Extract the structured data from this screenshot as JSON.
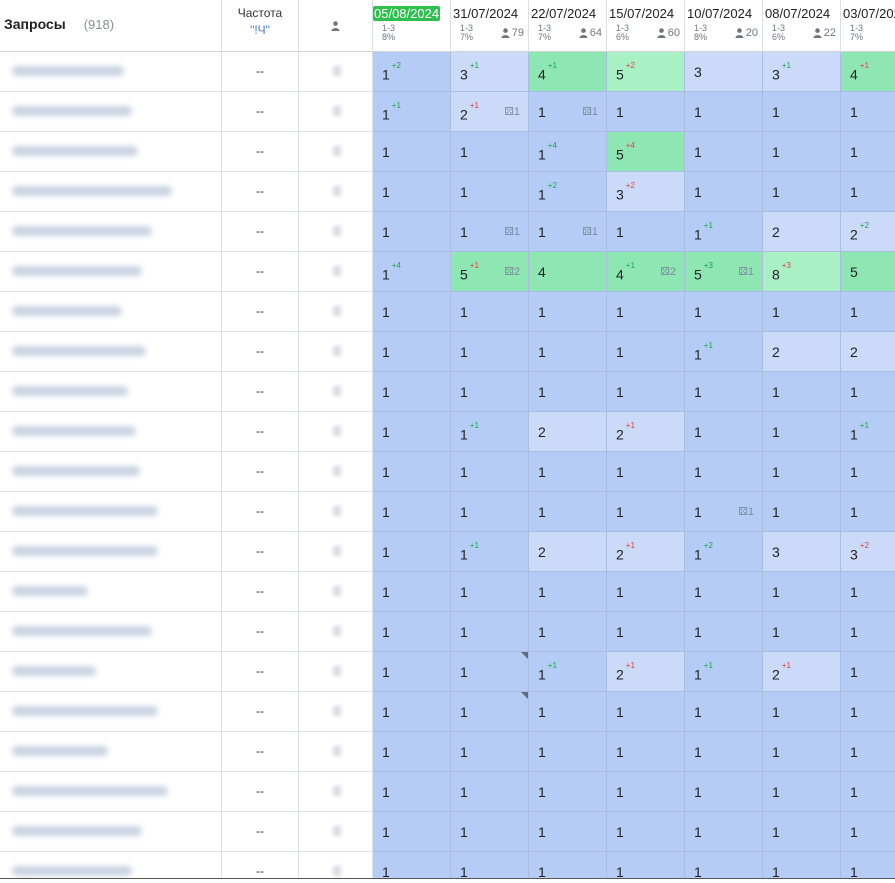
{
  "header": {
    "queries_label": "Запросы",
    "queries_count": "(918)",
    "frequency_label": "Частота",
    "frequency_sub": "\"!Ч\""
  },
  "columns": [
    {
      "date": "05/08/2024",
      "range": "1-3",
      "pct": "8%",
      "users": "",
      "highlight": true
    },
    {
      "date": "31/07/2024",
      "range": "1-3",
      "pct": "7%",
      "users": "79",
      "highlight": false
    },
    {
      "date": "22/07/2024",
      "range": "1-3",
      "pct": "7%",
      "users": "64",
      "highlight": false
    },
    {
      "date": "15/07/2024",
      "range": "1-3",
      "pct": "6%",
      "users": "60",
      "highlight": false
    },
    {
      "date": "10/07/2024",
      "range": "1-3",
      "pct": "8%",
      "users": "20",
      "highlight": false
    },
    {
      "date": "08/07/2024",
      "range": "1-3",
      "pct": "6%",
      "users": "22",
      "highlight": false
    },
    {
      "date": "03/07/2024",
      "range": "1-3",
      "pct": "7%",
      "users": "",
      "highlight": false
    }
  ],
  "rows": [
    {
      "freq": "--",
      "cells": [
        {
          "v": "1",
          "d": "+2",
          "t": "up",
          "c": 1
        },
        {
          "v": "3",
          "d": "+1",
          "t": "up",
          "c": 2
        },
        {
          "v": "4",
          "d": "+1",
          "t": "up",
          "c": 3
        },
        {
          "v": "5",
          "d": "+2",
          "t": "dn",
          "c": 4
        },
        {
          "v": "3",
          "c": 2
        },
        {
          "v": "3",
          "d": "+1",
          "t": "up",
          "c": 2
        },
        {
          "v": "4",
          "d": "+1",
          "t": "dn",
          "c": 3
        }
      ]
    },
    {
      "freq": "--",
      "cells": [
        {
          "v": "1",
          "d": "+1",
          "t": "up",
          "c": 1
        },
        {
          "v": "2",
          "d": "+1",
          "t": "dn",
          "s": "1",
          "c": 2
        },
        {
          "v": "1",
          "s": "1",
          "c": 1
        },
        {
          "v": "1",
          "c": 1
        },
        {
          "v": "1",
          "c": 1
        },
        {
          "v": "1",
          "c": 1
        },
        {
          "v": "1",
          "s": "",
          "c": 1
        }
      ]
    },
    {
      "freq": "--",
      "cells": [
        {
          "v": "1",
          "c": 1
        },
        {
          "v": "1",
          "c": 1
        },
        {
          "v": "1",
          "d": "+4",
          "t": "up",
          "c": 1
        },
        {
          "v": "5",
          "d": "+4",
          "t": "dn",
          "c": 3
        },
        {
          "v": "1",
          "c": 1
        },
        {
          "v": "1",
          "c": 1
        },
        {
          "v": "1",
          "c": 1
        }
      ]
    },
    {
      "freq": "--",
      "cells": [
        {
          "v": "1",
          "c": 1
        },
        {
          "v": "1",
          "c": 1
        },
        {
          "v": "1",
          "d": "+2",
          "t": "up",
          "c": 1
        },
        {
          "v": "3",
          "d": "+2",
          "t": "dn",
          "c": 2
        },
        {
          "v": "1",
          "c": 1
        },
        {
          "v": "1",
          "c": 1
        },
        {
          "v": "1",
          "c": 1
        }
      ]
    },
    {
      "freq": "--",
      "cells": [
        {
          "v": "1",
          "c": 1
        },
        {
          "v": "1",
          "s": "1",
          "c": 1
        },
        {
          "v": "1",
          "s": "1",
          "c": 1
        },
        {
          "v": "1",
          "c": 1
        },
        {
          "v": "1",
          "d": "+1",
          "t": "up",
          "c": 1
        },
        {
          "v": "2",
          "c": 2
        },
        {
          "v": "2",
          "d": "+2",
          "t": "up",
          "c": 2
        }
      ]
    },
    {
      "freq": "--",
      "cells": [
        {
          "v": "1",
          "d": "+4",
          "t": "up",
          "c": 1
        },
        {
          "v": "5",
          "d": "+1",
          "t": "dn",
          "s": "2",
          "c": 3
        },
        {
          "v": "4",
          "c": 3
        },
        {
          "v": "4",
          "d": "+1",
          "t": "up",
          "s": "2",
          "c": 3
        },
        {
          "v": "5",
          "d": "+3",
          "t": "up",
          "s": "1",
          "c": 3
        },
        {
          "v": "8",
          "d": "+3",
          "t": "dn",
          "c": 4
        },
        {
          "v": "5",
          "c": 3
        }
      ]
    },
    {
      "freq": "--",
      "cells": [
        {
          "v": "1",
          "c": 1
        },
        {
          "v": "1",
          "c": 1
        },
        {
          "v": "1",
          "c": 1
        },
        {
          "v": "1",
          "c": 1
        },
        {
          "v": "1",
          "c": 1
        },
        {
          "v": "1",
          "c": 1
        },
        {
          "v": "1",
          "c": 1
        }
      ]
    },
    {
      "freq": "--",
      "cells": [
        {
          "v": "1",
          "c": 1
        },
        {
          "v": "1",
          "c": 1
        },
        {
          "v": "1",
          "c": 1
        },
        {
          "v": "1",
          "c": 1
        },
        {
          "v": "1",
          "d": "+1",
          "t": "up",
          "c": 1
        },
        {
          "v": "2",
          "c": 2
        },
        {
          "v": "2",
          "c": 2
        }
      ]
    },
    {
      "freq": "--",
      "cells": [
        {
          "v": "1",
          "c": 1
        },
        {
          "v": "1",
          "c": 1
        },
        {
          "v": "1",
          "c": 1
        },
        {
          "v": "1",
          "c": 1
        },
        {
          "v": "1",
          "c": 1
        },
        {
          "v": "1",
          "c": 1
        },
        {
          "v": "1",
          "c": 1
        }
      ]
    },
    {
      "freq": "--",
      "cells": [
        {
          "v": "1",
          "c": 1
        },
        {
          "v": "1",
          "d": "+1",
          "t": "up",
          "c": 1
        },
        {
          "v": "2",
          "c": 2
        },
        {
          "v": "2",
          "d": "+1",
          "t": "dn",
          "c": 2
        },
        {
          "v": "1",
          "c": 1
        },
        {
          "v": "1",
          "c": 1
        },
        {
          "v": "1",
          "d": "+1",
          "t": "up",
          "c": 1
        }
      ]
    },
    {
      "freq": "--",
      "cells": [
        {
          "v": "1",
          "c": 1
        },
        {
          "v": "1",
          "c": 1
        },
        {
          "v": "1",
          "c": 1
        },
        {
          "v": "1",
          "c": 1
        },
        {
          "v": "1",
          "c": 1
        },
        {
          "v": "1",
          "c": 1
        },
        {
          "v": "1",
          "c": 1
        }
      ]
    },
    {
      "freq": "--",
      "cells": [
        {
          "v": "1",
          "c": 1
        },
        {
          "v": "1",
          "c": 1
        },
        {
          "v": "1",
          "c": 1
        },
        {
          "v": "1",
          "c": 1
        },
        {
          "v": "1",
          "s": "1",
          "c": 1
        },
        {
          "v": "1",
          "c": 1
        },
        {
          "v": "1",
          "c": 1
        }
      ]
    },
    {
      "freq": "--",
      "cells": [
        {
          "v": "1",
          "c": 1
        },
        {
          "v": "1",
          "d": "+1",
          "t": "up",
          "c": 1
        },
        {
          "v": "2",
          "c": 2
        },
        {
          "v": "2",
          "d": "+1",
          "t": "dn",
          "c": 2
        },
        {
          "v": "1",
          "d": "+2",
          "t": "up",
          "c": 1
        },
        {
          "v": "3",
          "c": 2
        },
        {
          "v": "3",
          "d": "+2",
          "t": "dn",
          "c": 2
        }
      ]
    },
    {
      "freq": "--",
      "cells": [
        {
          "v": "1",
          "c": 1
        },
        {
          "v": "1",
          "c": 1
        },
        {
          "v": "1",
          "c": 1
        },
        {
          "v": "1",
          "c": 1
        },
        {
          "v": "1",
          "c": 1
        },
        {
          "v": "1",
          "c": 1
        },
        {
          "v": "1",
          "c": 1
        }
      ]
    },
    {
      "freq": "--",
      "cells": [
        {
          "v": "1",
          "c": 1
        },
        {
          "v": "1",
          "c": 1
        },
        {
          "v": "1",
          "c": 1
        },
        {
          "v": "1",
          "c": 1
        },
        {
          "v": "1",
          "c": 1
        },
        {
          "v": "1",
          "c": 1
        },
        {
          "v": "1",
          "c": 1
        }
      ]
    },
    {
      "freq": "--",
      "cells": [
        {
          "v": "1",
          "c": 1
        },
        {
          "v": "1",
          "tri": true,
          "c": 1
        },
        {
          "v": "1",
          "d": "+1",
          "t": "up",
          "c": 1
        },
        {
          "v": "2",
          "d": "+1",
          "t": "dn",
          "c": 2
        },
        {
          "v": "1",
          "d": "+1",
          "t": "up",
          "c": 1
        },
        {
          "v": "2",
          "d": "+1",
          "t": "dn",
          "c": 2
        },
        {
          "v": "1",
          "c": 1
        }
      ]
    },
    {
      "freq": "--",
      "cells": [
        {
          "v": "1",
          "c": 1
        },
        {
          "v": "1",
          "tri": true,
          "c": 1
        },
        {
          "v": "1",
          "c": 1
        },
        {
          "v": "1",
          "c": 1
        },
        {
          "v": "1",
          "c": 1
        },
        {
          "v": "1",
          "c": 1
        },
        {
          "v": "1",
          "c": 1
        }
      ]
    },
    {
      "freq": "--",
      "cells": [
        {
          "v": "1",
          "c": 1
        },
        {
          "v": "1",
          "c": 1
        },
        {
          "v": "1",
          "c": 1
        },
        {
          "v": "1",
          "c": 1
        },
        {
          "v": "1",
          "c": 1
        },
        {
          "v": "1",
          "c": 1
        },
        {
          "v": "1",
          "c": 1
        }
      ]
    },
    {
      "freq": "--",
      "cells": [
        {
          "v": "1",
          "c": 1
        },
        {
          "v": "1",
          "c": 1
        },
        {
          "v": "1",
          "c": 1
        },
        {
          "v": "1",
          "c": 1
        },
        {
          "v": "1",
          "c": 1
        },
        {
          "v": "1",
          "c": 1
        },
        {
          "v": "1",
          "c": 1
        }
      ]
    },
    {
      "freq": "--",
      "cells": [
        {
          "v": "1",
          "c": 1
        },
        {
          "v": "1",
          "c": 1
        },
        {
          "v": "1",
          "c": 1
        },
        {
          "v": "1",
          "c": 1
        },
        {
          "v": "1",
          "c": 1
        },
        {
          "v": "1",
          "c": 1
        },
        {
          "v": "1",
          "c": 1
        }
      ]
    },
    {
      "freq": "--",
      "cells": [
        {
          "v": "1",
          "c": 1
        },
        {
          "v": "1",
          "c": 1
        },
        {
          "v": "1",
          "c": 1
        },
        {
          "v": "1",
          "c": 1
        },
        {
          "v": "1",
          "c": 1
        },
        {
          "v": "1",
          "c": 1
        },
        {
          "v": "1",
          "c": 1
        }
      ]
    }
  ]
}
